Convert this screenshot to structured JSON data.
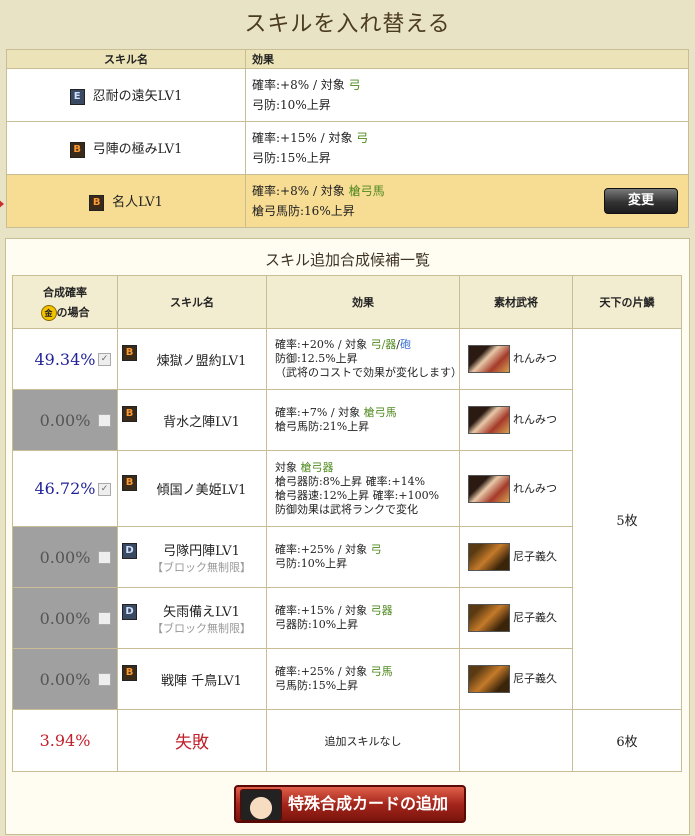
{
  "page_title": "スキルを入れ替える",
  "current_skills": {
    "headers": {
      "name": "スキル名",
      "effect": "効果"
    },
    "rows": [
      {
        "rank": "E",
        "name": "忍耐の遠矢LV1",
        "effect_prefix": "確率:+8% / 対象",
        "target": "弓",
        "effect_line2": "弓防:10%上昇",
        "selected": false
      },
      {
        "rank": "B",
        "name": "弓陣の極みLV1",
        "effect_prefix": "確率:+15% / 対象",
        "target": "弓",
        "effect_line2": "弓防:15%上昇",
        "selected": false
      },
      {
        "rank": "B",
        "name": "名人LV1",
        "effect_prefix": "確率:+8% / 対象",
        "target": "槍弓馬",
        "effect_line2": "槍弓馬防:16%上昇",
        "selected": true
      }
    ],
    "change_button": "変更"
  },
  "candidates": {
    "title": "スキル追加合成候補一覧",
    "headers": {
      "rate": "合成確率",
      "gold_icon": "金",
      "gold_case": "の場合",
      "name": "スキル名",
      "effect": "効果",
      "material": "素材武将",
      "tenka": "天下の片鱗"
    },
    "rows": [
      {
        "rate": "49.34%",
        "checked": true,
        "rank": "B",
        "name": "煉獄ノ盟約LV1",
        "sub": "",
        "eff1a": "確率:+20% / 対象",
        "eff1b": "弓/器",
        "eff1sep": "/",
        "eff1c": "砲",
        "eff2": "防御:12.5%上昇",
        "eff3": "（武将のコストで効果が変化します）",
        "material": "れんみつ"
      },
      {
        "rate": "0.00%",
        "checked": false,
        "rank": "B",
        "name": "背水之陣LV1",
        "sub": "",
        "eff1a": "確率:+7% / 対象",
        "eff1b": "槍弓馬",
        "eff2": "槍弓馬防:21%上昇",
        "material": "れんみつ"
      },
      {
        "rate": "46.72%",
        "checked": true,
        "rank": "B",
        "name": "傾国ノ美姫LV1",
        "sub": "",
        "eff1a": "対象",
        "eff1b": "槍弓器",
        "eff2": "槍弓器防:8%上昇 確率:+14%",
        "eff3": "槍弓器速:12%上昇 確率:+100%",
        "eff4": "防御効果は武将ランクで変化",
        "material": "れんみつ"
      },
      {
        "rate": "0.00%",
        "checked": false,
        "rank": "D",
        "name": "弓隊円陣LV1",
        "sub": "【ブロック無制限】",
        "eff1a": "確率:+25% / 対象",
        "eff1b": "弓",
        "eff2": "弓防:10%上昇",
        "material": "尼子義久"
      },
      {
        "rate": "0.00%",
        "checked": false,
        "rank": "D",
        "name": "矢雨備えLV1",
        "sub": "【ブロック無制限】",
        "eff1a": "確率:+15% / 対象",
        "eff1b": "弓器",
        "eff2": "弓器防:10%上昇",
        "material": "尼子義久"
      },
      {
        "rate": "0.00%",
        "checked": false,
        "rank": "B",
        "name": "戦陣 千鳥LV1",
        "sub": "",
        "eff1a": "確率:+25% / 対象",
        "eff1b": "弓馬",
        "eff2": "弓馬防:15%上昇",
        "material": "尼子義久"
      }
    ],
    "tenka_group": "5枚",
    "fail_row": {
      "rate": "3.94%",
      "label": "失敗",
      "effect": "追加スキルなし",
      "tenka": "6枚"
    },
    "add_card_button": "特殊合成カードの追加"
  }
}
